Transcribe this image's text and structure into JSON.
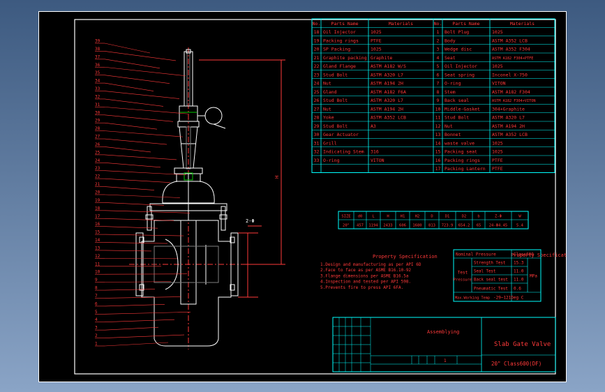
{
  "balloons": [
    "39",
    "38",
    "37",
    "36",
    "35",
    "34",
    "33",
    "32",
    "31",
    "30",
    "29",
    "28",
    "27",
    "26",
    "25",
    "24",
    "23",
    "22",
    "21",
    "20",
    "19",
    "18",
    "17",
    "16",
    "15",
    "14",
    "13",
    "12",
    "11",
    "10",
    "9",
    "8",
    "7",
    "6",
    "5",
    "4",
    "3",
    "2",
    "1"
  ],
  "dims": {
    "height": "H",
    "section": "2-Φ"
  },
  "parts_table": {
    "headers": [
      "No.",
      "Parts Name",
      "Materials",
      "No.",
      "Parts Name",
      "Materials"
    ],
    "left": [
      [
        "18",
        "Oil Injector",
        "1025"
      ],
      [
        "19",
        "Packing rings",
        "PTFE"
      ],
      [
        "20",
        "SP Packing",
        "1025"
      ],
      [
        "21",
        "Graphite packing",
        "Graphite"
      ],
      [
        "22",
        "Gland Flange",
        "ASTM A182 W/S"
      ],
      [
        "23",
        "Stud Bolt",
        "ASTM A320 L7"
      ],
      [
        "24",
        "Nut",
        "ASTM A194 2H"
      ],
      [
        "25",
        "Gland",
        "ASTM A182 F6A"
      ],
      [
        "26",
        "Stud Bolt",
        "ASTM A320 L7"
      ],
      [
        "27",
        "Nut",
        "ASTM A194 2H"
      ],
      [
        "28",
        "Yoke",
        "ASTM A352 LCB"
      ],
      [
        "29",
        "Stud Bolt",
        "A3"
      ],
      [
        "30",
        "Gear Actuator",
        ""
      ],
      [
        "31",
        "Grill",
        ""
      ],
      [
        "32",
        "Indicating Stem",
        "316"
      ],
      [
        "33",
        "O-ring",
        "VITON"
      ],
      [
        "",
        "",
        " "
      ]
    ],
    "right": [
      [
        "1",
        "Bolt Plug",
        "1025"
      ],
      [
        "2",
        "Body",
        "ASTM A352 LCB"
      ],
      [
        "3",
        "Wedge disc",
        "ASTM A352 F304"
      ],
      [
        "4",
        "Seat",
        "ASTM A182 F304+PTFE"
      ],
      [
        "5",
        "Oil Injector",
        "1025"
      ],
      [
        "6",
        "Seat spring",
        "Inconel X-750"
      ],
      [
        "7",
        "O-ring",
        "VITON"
      ],
      [
        "8",
        "Stem",
        "ASTM A182 F304"
      ],
      [
        "9",
        "Back seal",
        "ASTM A182 F304+VITON"
      ],
      [
        "10",
        "Middle-Gasket",
        "304+Graphite"
      ],
      [
        "11",
        "Stud Bolt",
        "ASTM A320 L7"
      ],
      [
        "12",
        "Nut",
        "ASTM A194 2H"
      ],
      [
        "13",
        "Bonnet",
        "ASTM A352 LCB"
      ],
      [
        "14",
        "waste valve",
        "1025"
      ],
      [
        "15",
        "Packing seat",
        "1025"
      ],
      [
        "16",
        "Packing rings",
        "PTFE"
      ],
      [
        "17",
        "Packing Lantern",
        "PTFE"
      ]
    ]
  },
  "size_table": {
    "headers": [
      "SIZE",
      "d0",
      "L",
      "H",
      "H1",
      "H2",
      "D",
      "D1",
      "D2",
      "b",
      "Z-Φ",
      "W"
    ],
    "values": [
      "20\"",
      "457",
      "1194",
      "2433",
      "606",
      "1680",
      "813",
      "723.9",
      "654.2",
      "65",
      "24-Φ4.45",
      "5.4"
    ]
  },
  "property_spec": {
    "title": "Property Specification",
    "items": [
      "1.Design and manufacturing as per API 6D",
      "2.Face to face as per ASME B16.10-92",
      "3.Flange dimensions per ASME B16.5a",
      "4.Inspection and tested per API 598.",
      "5.Prevents fire to press API 6FA."
    ]
  },
  "pressure_spec": {
    "title": "Property Specification",
    "nominal_label": "Nominal Pressure",
    "nominal_value": "Class600",
    "test_label": "Test Pressure",
    "rows": [
      [
        "Strength Test",
        "15.3"
      ],
      [
        "Seal Test",
        "11.0"
      ],
      [
        "Back seal test",
        "11.0"
      ],
      [
        "Pneumatic Test",
        "0.6"
      ]
    ],
    "unit": "MPa",
    "temp_label": "Max.Working Temp",
    "temp_value": "-29~121Deg C"
  },
  "title_block": {
    "assembling": "Assemblying",
    "scale": "1",
    "name": "Slab Gate Valve",
    "spec": "20\"  Class600(DF)"
  },
  "colors": {
    "frame": "#ffffff",
    "table": "#00ffff",
    "text": "#ff3a3a",
    "drawing": "#ff3a3a",
    "valve": "#ffffff",
    "motor": "#00c800"
  }
}
